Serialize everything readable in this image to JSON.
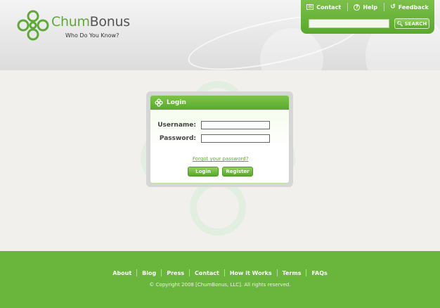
{
  "brand": {
    "name_part1": "Chum",
    "name_part2": "Bonus",
    "tagline": "Who Do You Know?"
  },
  "topnav": {
    "items": [
      {
        "label": "Contact",
        "icon": "envelope-icon"
      },
      {
        "label": "Help",
        "icon": "question-icon"
      },
      {
        "label": "Feedback",
        "icon": "feedback-icon"
      }
    ]
  },
  "search": {
    "value": "",
    "button_label": "SEARCH"
  },
  "login": {
    "title": "Login",
    "username_label": "Username:",
    "password_label": "Password:",
    "username_value": "",
    "password_value": "",
    "forgot_link": "Forgot your password?",
    "login_button": "Login",
    "register_button": "Register"
  },
  "footer": {
    "links": [
      "About",
      "Blog",
      "Press",
      "Contact",
      "How it Works",
      "Terms",
      "FAQs"
    ],
    "copyright": "© Copyright 2008 [ChumBonus, LLC]. All rights reserved."
  },
  "colors": {
    "brand_green": "#6ab63c",
    "header_gray": "#dcdcdc",
    "background": "#f1f0ec"
  }
}
